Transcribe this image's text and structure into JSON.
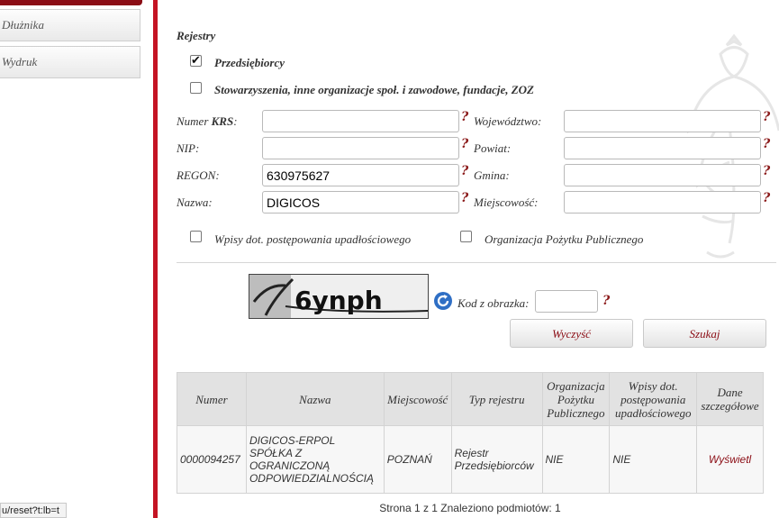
{
  "sidebar": {
    "items": [
      {
        "label": "Dłużnika"
      },
      {
        "label": "Wydruk"
      }
    ]
  },
  "statusbar": {
    "text": "u/reset?t:lb=t"
  },
  "form": {
    "section_title": "Rejestry",
    "registry_options": [
      {
        "label": "Przedsiębiorcy",
        "checked": true
      },
      {
        "label": "Stowarzyszenia, inne organizacje społ. i zawodowe, fundacje, ZOZ",
        "checked": false
      }
    ],
    "fields_left": [
      {
        "label_prefix": "Numer ",
        "label_bold": "KRS",
        "label_suffix": ":",
        "value": ""
      },
      {
        "label_prefix": "NIP:",
        "label_bold": "",
        "label_suffix": "",
        "value": ""
      },
      {
        "label_prefix": "REGON:",
        "label_bold": "",
        "label_suffix": "",
        "value": "630975627"
      },
      {
        "label_prefix": "Nazwa:",
        "label_bold": "",
        "label_suffix": "",
        "value": "DIGICOS"
      }
    ],
    "fields_right": [
      {
        "label": "Województwo:",
        "value": ""
      },
      {
        "label": "Powiat:",
        "value": ""
      },
      {
        "label": "Gmina:",
        "value": ""
      },
      {
        "label": "Miejscowość:",
        "value": ""
      }
    ],
    "help_mark": "?",
    "extra_options": [
      {
        "label": "Wpisy dot. postępowania upadłościowego",
        "checked": false
      },
      {
        "label": "Organizacja Pożytku Publicznego",
        "checked": false
      }
    ],
    "captcha": {
      "image_text": "6ynph",
      "label": "Kod z obrazka:",
      "value": ""
    },
    "buttons": {
      "clear": "Wyczyść",
      "search": "Szukaj"
    }
  },
  "results": {
    "columns": [
      "Numer",
      "Nazwa",
      "Miejscowość",
      "Typ rejestru",
      "Organizacja Pożytku Publicznego",
      "Wpisy dot. postępowania upadłościowego",
      "Dane szczegółowe"
    ],
    "rows": [
      {
        "numer": "0000094257",
        "nazwa": "DIGICOS-ERPOL SPÓŁKA Z OGRANICZONĄ ODPOWIEDZIALNOŚCIĄ",
        "miejscowosc": "POZNAŃ",
        "typ": "Rejestr Przedsiębiorców",
        "opp": "NIE",
        "upadlosc": "NIE",
        "link": "Wyświetl"
      }
    ],
    "pager": "Strona 1 z 1 Znaleziono podmiotów: 1"
  },
  "colors": {
    "accent": "#c41424",
    "dark_red": "#8b0d15"
  },
  "icons": {
    "refresh": "refresh-icon",
    "checkbox_checked": "checkmark-icon",
    "emblem": "eagle-emblem"
  }
}
